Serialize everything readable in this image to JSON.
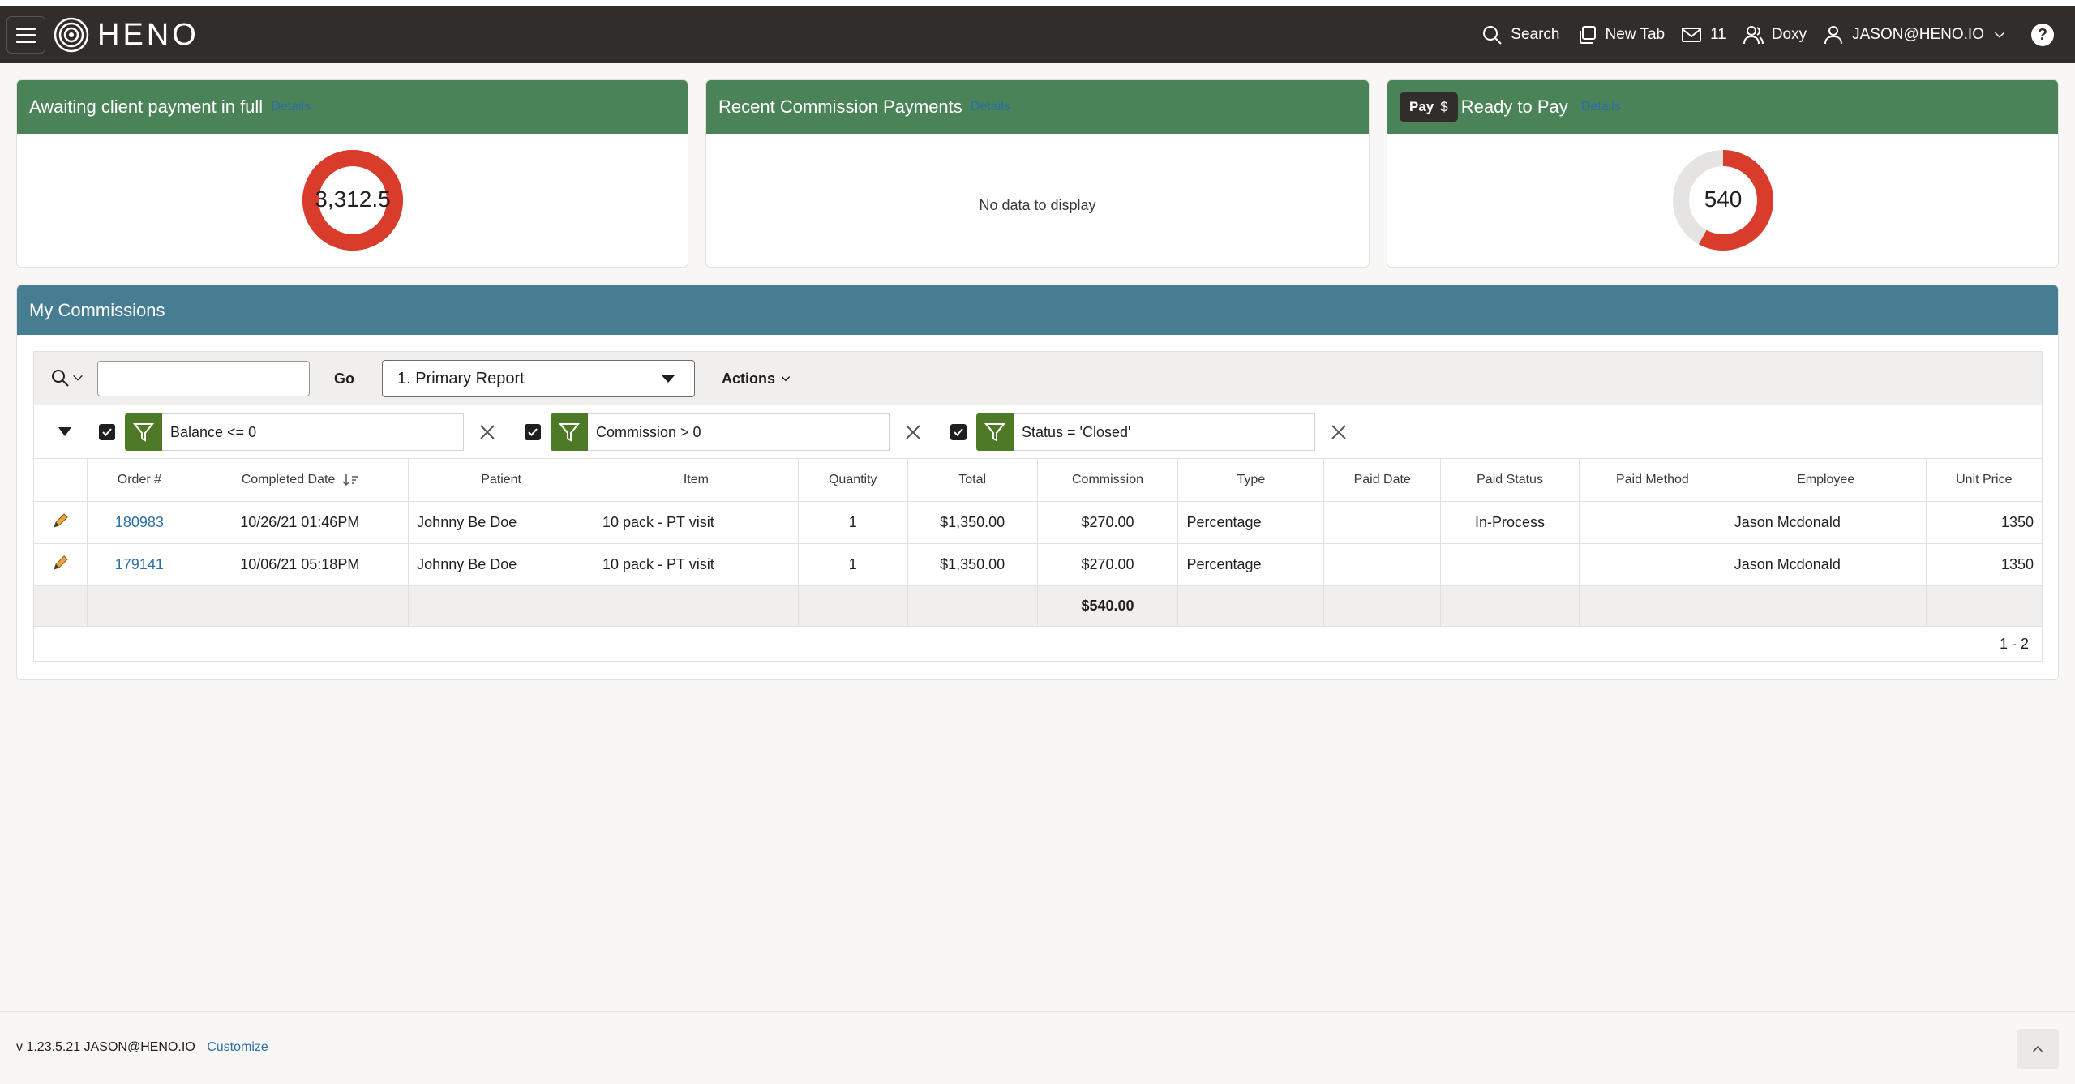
{
  "header": {
    "logo_text": "HENO",
    "search_label": "Search",
    "new_tab_label": "New Tab",
    "mail_count": "11",
    "doxy_label": "Doxy",
    "user_label": "JASON@HENO.IO",
    "help_label": "?"
  },
  "cards": {
    "awaiting": {
      "title": "Awaiting client payment in full",
      "details": "Details",
      "value": "3,312.5",
      "fraction": 1.0,
      "color": "#d93c2b"
    },
    "recent": {
      "title": "Recent Commission Payments",
      "details": "Details",
      "empty_text": "No data to display"
    },
    "ready": {
      "pay_label": "Pay",
      "pay_icon": "dollar-icon",
      "title": "Ready to Pay",
      "details": "Details",
      "value": "540",
      "fraction": 0.58,
      "color": "#d93c2b",
      "track_color": "#e6e4e2"
    }
  },
  "commissions": {
    "title": "My Commissions",
    "search_value": "",
    "go_label": "Go",
    "report_selected": "1. Primary Report",
    "actions_label": "Actions",
    "filters": [
      {
        "text": "Balance <= 0",
        "checked": true
      },
      {
        "text": "Commission > 0",
        "checked": true
      },
      {
        "text": "Status = 'Closed'",
        "checked": true
      }
    ],
    "columns": [
      "Order #",
      "Completed Date",
      "Patient",
      "Item",
      "Quantity",
      "Total",
      "Commission",
      "Type",
      "Paid Date",
      "Paid Status",
      "Paid Method",
      "Employee",
      "Unit Price"
    ],
    "rows": [
      {
        "order": "180983",
        "completed": "10/26/21 01:46PM",
        "patient": "Johnny Be Doe",
        "item": "10 pack - PT visit",
        "quantity": "1",
        "total": "$1,350.00",
        "commission": "$270.00",
        "type": "Percentage",
        "paid_date": "",
        "paid_status": "In-Process",
        "paid_method": "",
        "employee": "Jason Mcdonald",
        "unit_price": "1350"
      },
      {
        "order": "179141",
        "completed": "10/06/21 05:18PM",
        "patient": "Johnny Be Doe",
        "item": "10 pack - PT visit",
        "quantity": "1",
        "total": "$1,350.00",
        "commission": "$270.00",
        "type": "Percentage",
        "paid_date": "",
        "paid_status": "",
        "paid_method": "",
        "employee": "Jason Mcdonald",
        "unit_price": "1350"
      }
    ],
    "commission_total": "$540.00",
    "pagination": "1 - 2"
  },
  "footer": {
    "version_text": "v 1.23.5.21 JASON@HENO.IO",
    "customize_label": "Customize"
  },
  "colors": {
    "topbar": "#312d2a",
    "card_header": "#4b8359",
    "region_header": "#477d93",
    "filter_green": "#4e7a27",
    "link": "#2b6ea8"
  }
}
